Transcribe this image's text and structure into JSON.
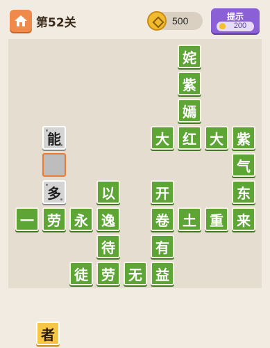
{
  "header": {
    "level": "第52关",
    "coins": "500",
    "hint_label": "提示",
    "hint_cost": "200"
  },
  "board": {
    "tiles": [
      {
        "text": "姹",
        "style": "green",
        "col": 6,
        "row": 0
      },
      {
        "text": "紫",
        "style": "green",
        "col": 6,
        "row": 1
      },
      {
        "text": "嫣",
        "style": "green",
        "col": 6,
        "row": 2
      },
      {
        "text": "能",
        "style": "grey",
        "col": 1,
        "row": 3
      },
      {
        "text": "大",
        "style": "green",
        "col": 5,
        "row": 3
      },
      {
        "text": "红",
        "style": "green",
        "col": 6,
        "row": 3
      },
      {
        "text": "大",
        "style": "green",
        "col": 7,
        "row": 3
      },
      {
        "text": "紫",
        "style": "green",
        "col": 8,
        "row": 3
      },
      {
        "text": "",
        "style": "empty",
        "col": 1,
        "row": 4
      },
      {
        "text": "气",
        "style": "green",
        "col": 8,
        "row": 4
      },
      {
        "text": "多",
        "style": "grey",
        "col": 1,
        "row": 5
      },
      {
        "text": "以",
        "style": "green",
        "col": 3,
        "row": 5
      },
      {
        "text": "开",
        "style": "green",
        "col": 5,
        "row": 5
      },
      {
        "text": "东",
        "style": "green",
        "col": 8,
        "row": 5
      },
      {
        "text": "一",
        "style": "green",
        "col": 0,
        "row": 6
      },
      {
        "text": "劳",
        "style": "green",
        "col": 1,
        "row": 6
      },
      {
        "text": "永",
        "style": "green",
        "col": 2,
        "row": 6
      },
      {
        "text": "逸",
        "style": "green",
        "col": 3,
        "row": 6
      },
      {
        "text": "卷",
        "style": "green",
        "col": 5,
        "row": 6
      },
      {
        "text": "土",
        "style": "green",
        "col": 6,
        "row": 6
      },
      {
        "text": "重",
        "style": "green",
        "col": 7,
        "row": 6
      },
      {
        "text": "来",
        "style": "green",
        "col": 8,
        "row": 6
      },
      {
        "text": "待",
        "style": "green",
        "col": 3,
        "row": 7
      },
      {
        "text": "有",
        "style": "green",
        "col": 5,
        "row": 7
      },
      {
        "text": "徒",
        "style": "green",
        "col": 2,
        "row": 8
      },
      {
        "text": "劳",
        "style": "green",
        "col": 3,
        "row": 8
      },
      {
        "text": "无",
        "style": "green",
        "col": 4,
        "row": 8
      },
      {
        "text": "益",
        "style": "green",
        "col": 5,
        "row": 8
      }
    ]
  },
  "choices": [
    {
      "text": "者"
    }
  ]
}
